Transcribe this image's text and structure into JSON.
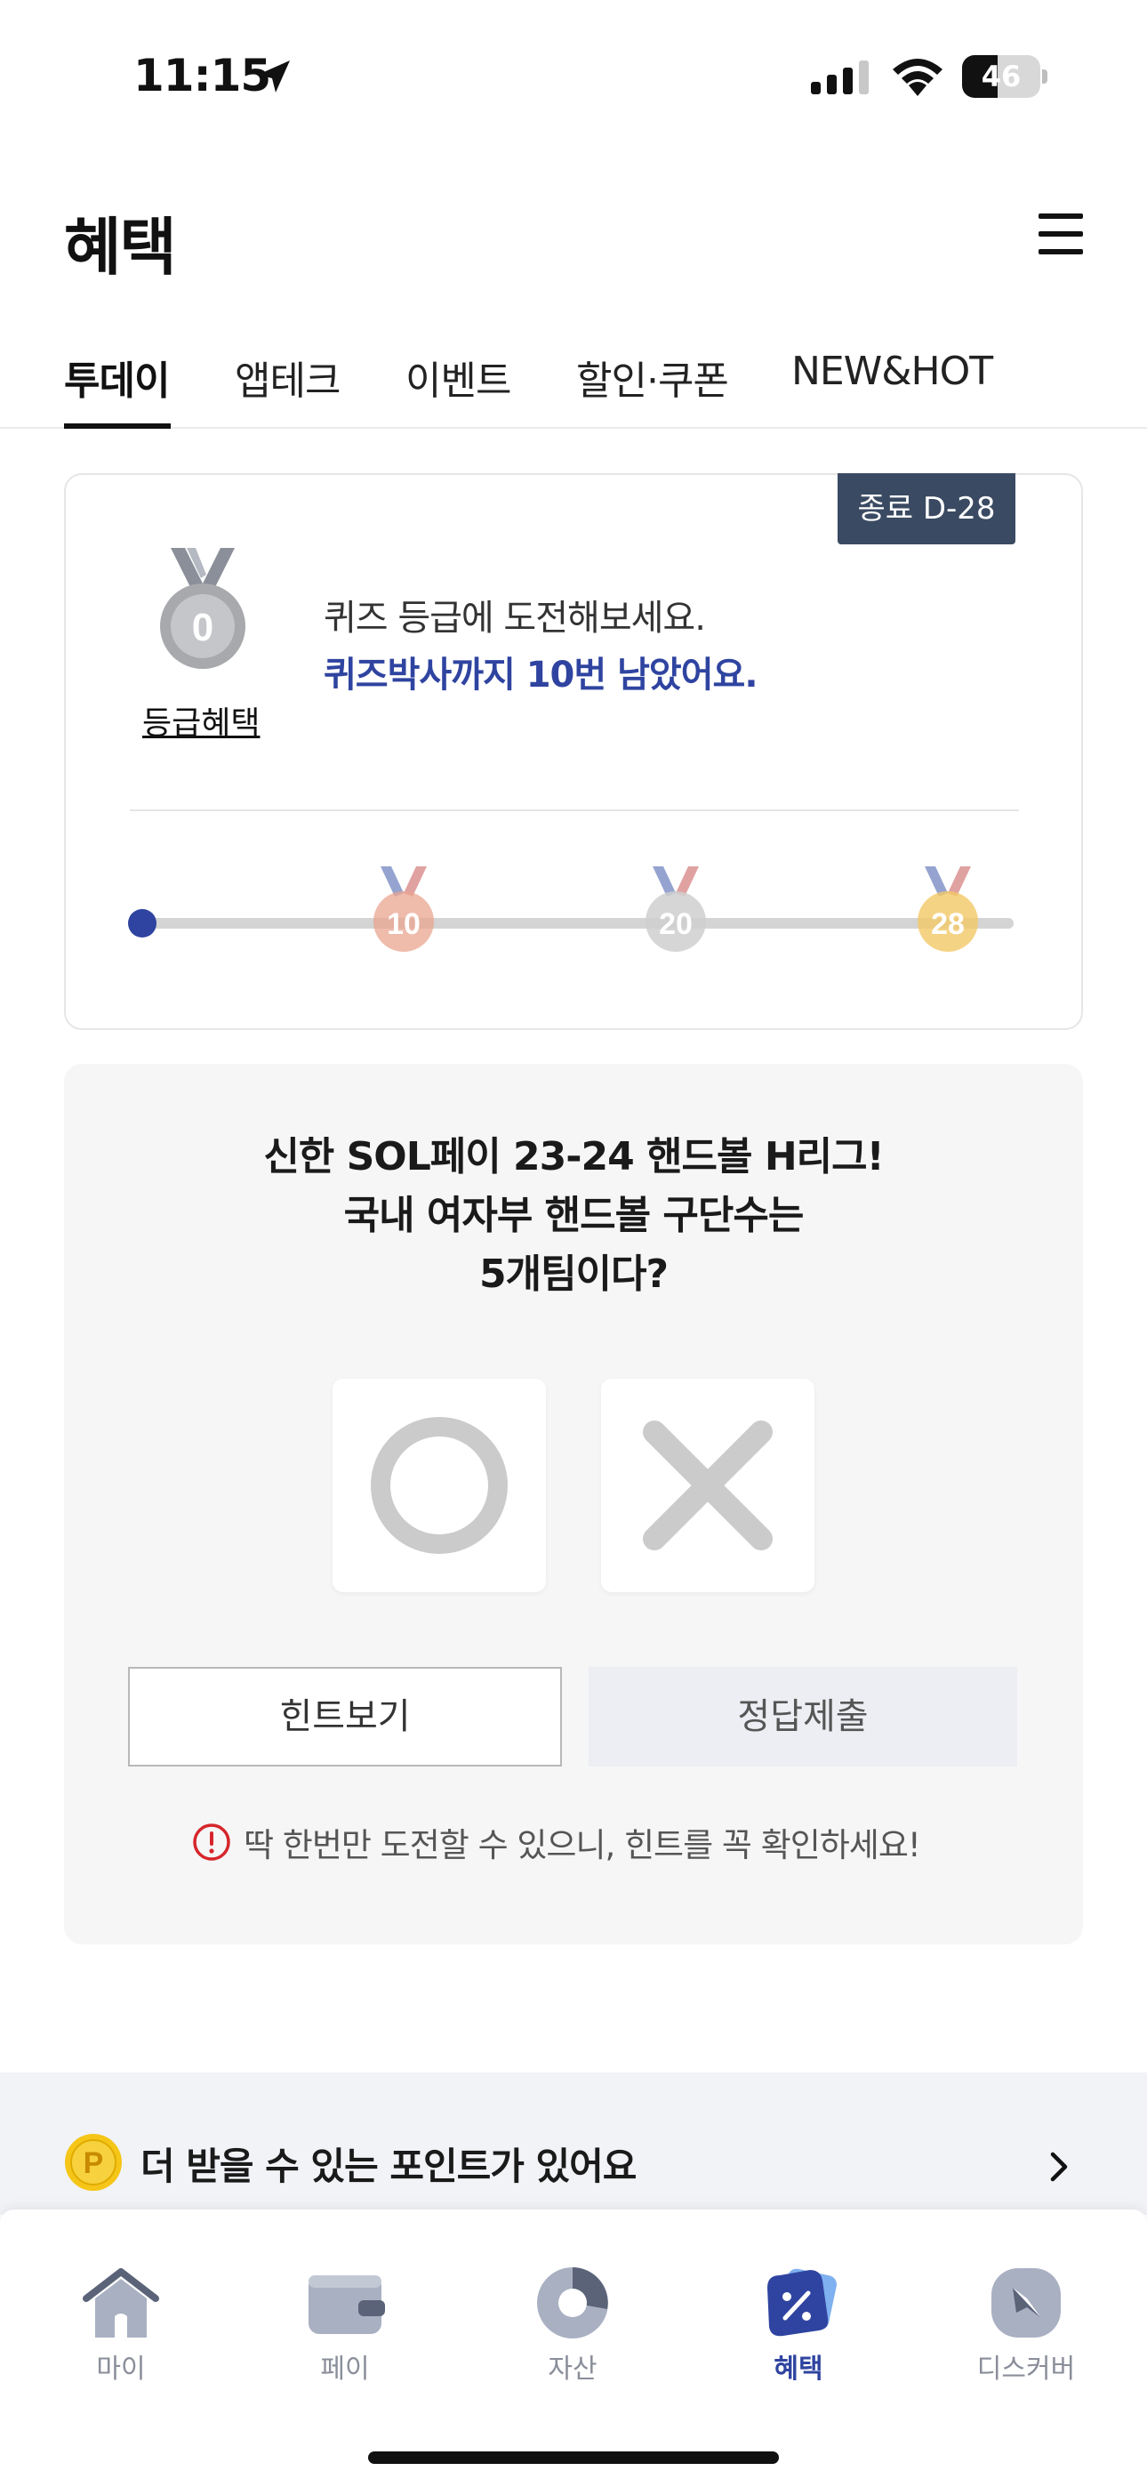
{
  "status_bar": {
    "time": "11:15",
    "battery": "46",
    "battery_level": 0.46
  },
  "header": {
    "title": "혜택",
    "menu_icon": "hamburger-menu-icon"
  },
  "tabs": [
    {
      "label": "투데이",
      "active": true
    },
    {
      "label": "앱테크",
      "active": false
    },
    {
      "label": "이벤트",
      "active": false
    },
    {
      "label": "할인·쿠폰",
      "active": false
    },
    {
      "label": "NEW&HOT",
      "active": false
    }
  ],
  "grade_card": {
    "badge": "종료 D-28",
    "medal_value": "0",
    "grade_link": "등급혜택",
    "line1": "퀴즈 등급에 도전해보세요.",
    "line2": "퀴즈박사까지 10번 남았어요.",
    "progress": 0,
    "milestones": [
      "10",
      "20",
      "28"
    ],
    "milestone_colors": [
      "#e9a48f",
      "#cfcfcf",
      "#f3c867"
    ],
    "accent": "#2f44a0"
  },
  "quiz": {
    "question_lines": [
      "신한 SOL페이 23-24 핸드볼 H리그!",
      "국내 여자부 핸드볼 구단수는",
      "5개팀이다?"
    ],
    "option_o": "circle-o-icon",
    "option_x": "cross-x-icon",
    "hint_button": "힌트보기",
    "submit_button": "정답제출",
    "warning": "딱 한번만 도전할 수 있으니, 힌트를 꼭 확인하세요!"
  },
  "points_banner": {
    "text": "더 받을 수 있는 포인트가 있어요"
  },
  "bottom_nav": [
    {
      "label": "마이",
      "icon": "home-icon",
      "active": false
    },
    {
      "label": "페이",
      "icon": "wallet-icon",
      "active": false
    },
    {
      "label": "자산",
      "icon": "pie-chart-icon",
      "active": false
    },
    {
      "label": "혜택",
      "icon": "coupon-tag-icon",
      "active": true
    },
    {
      "label": "디스커버",
      "icon": "compass-icon",
      "active": false
    }
  ]
}
